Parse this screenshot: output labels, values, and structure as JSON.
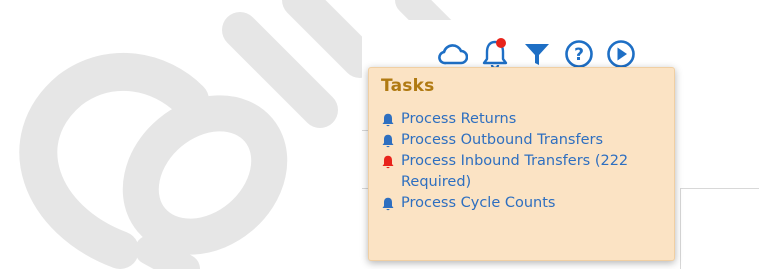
{
  "toolbar": {
    "icons": [
      "cloud-icon",
      "notification-bell-icon",
      "filter-icon",
      "help-icon",
      "play-icon"
    ],
    "notification_dot_color": "#e8241b",
    "icon_color": "#1e6fc5"
  },
  "tasks_popup": {
    "title": "Tasks",
    "background_color": "#fbe3c4",
    "title_color": "#b07a12",
    "link_color": "#2e6fc0",
    "items": [
      {
        "label": "Process Returns",
        "bell_color": "#2e6fc0",
        "alert": false
      },
      {
        "label": "Process Outbound Transfers",
        "bell_color": "#2e6fc0",
        "alert": false
      },
      {
        "label": "Process Inbound Transfers (222 Required)",
        "bell_color": "#e8241b",
        "alert": true
      },
      {
        "label": "Process Cycle Counts",
        "bell_color": "#2e6fc0",
        "alert": false
      }
    ]
  },
  "watermark": {
    "text": "CONF",
    "color": "#e6e6e6"
  }
}
